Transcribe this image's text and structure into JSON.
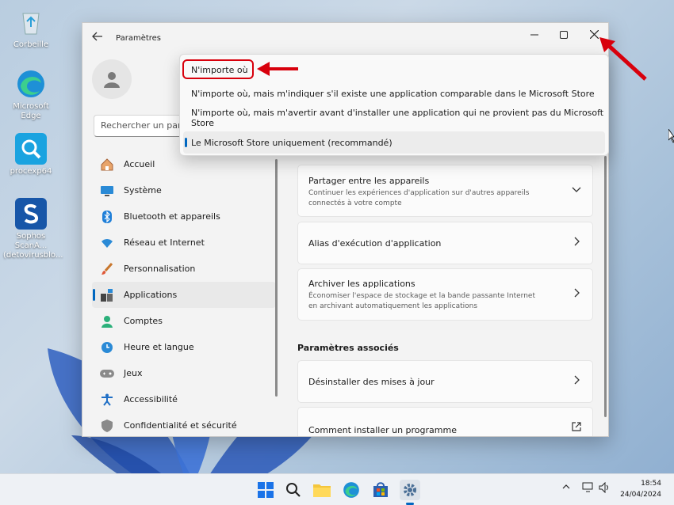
{
  "desktop": {
    "icons": [
      {
        "label": "Corbeille",
        "icon": "recycle-bin-icon"
      },
      {
        "label": "Microsoft Edge",
        "icon": "edge-icon"
      },
      {
        "label": "procexp64",
        "icon": "procexp-icon"
      },
      {
        "label": "Sophos ScanA... (detovirusblo...",
        "icon": "sophos-icon"
      }
    ]
  },
  "window": {
    "title": "Paramètres",
    "search_placeholder": "Rechercher un paramètre"
  },
  "nav": {
    "items": [
      {
        "label": "Accueil",
        "icon": "home-icon"
      },
      {
        "label": "Système",
        "icon": "display-icon"
      },
      {
        "label": "Bluetooth et appareils",
        "icon": "bluetooth-icon"
      },
      {
        "label": "Réseau et Internet",
        "icon": "wifi-icon"
      },
      {
        "label": "Personnalisation",
        "icon": "brush-icon"
      },
      {
        "label": "Applications",
        "icon": "apps-icon",
        "active": true
      },
      {
        "label": "Comptes",
        "icon": "person-icon"
      },
      {
        "label": "Heure et langue",
        "icon": "clock-globe-icon"
      },
      {
        "label": "Jeux",
        "icon": "gamepad-icon"
      },
      {
        "label": "Accessibilité",
        "icon": "accessibility-icon"
      },
      {
        "label": "Confidentialité et sécurité",
        "icon": "shield-icon"
      }
    ]
  },
  "dropdown": {
    "options": [
      "N'importe où",
      "N'importe où, mais m'indiquer s'il existe une application comparable dans le Microsoft Store",
      "N'importe où, mais m'avertir avant d'installer une application qui ne provient pas du Microsoft Store",
      "Le Microsoft Store uniquement (recommandé)"
    ],
    "selected_index": 3,
    "highlighted_index": 0
  },
  "main": {
    "cards": [
      {
        "title": "Partager entre les appareils",
        "subtitle": "Continuer les expériences d'application sur d'autres appareils connectés à votre compte",
        "action": "chevron-down-icon"
      },
      {
        "title": "Alias d'exécution d'application",
        "subtitle": "",
        "action": "chevron-right-icon"
      },
      {
        "title": "Archiver les applications",
        "subtitle": "Économiser l'espace de stockage et la bande passante Internet en archivant automatiquement les applications",
        "action": "chevron-right-icon"
      }
    ],
    "related_title": "Paramètres associés",
    "related": [
      {
        "title": "Désinstaller des mises à jour",
        "action": "chevron-right-icon"
      },
      {
        "title": "Comment installer un programme",
        "action": "external-link-icon"
      }
    ]
  },
  "taskbar": {
    "time": "18:54",
    "date": "24/04/2024"
  },
  "colors": {
    "accent": "#0067c0",
    "annotation_red": "#d8000c"
  }
}
